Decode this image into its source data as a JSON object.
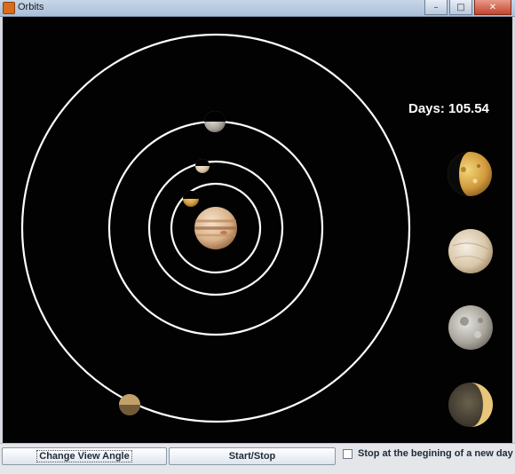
{
  "window": {
    "title": "Orbits",
    "controls": {
      "minimize": "–",
      "maximize": "□",
      "close": "✕"
    }
  },
  "simulation": {
    "days_label": "Days: 105.54",
    "central_body": "jupiter",
    "moons": [
      "io",
      "europa",
      "ganymede",
      "callisto"
    ],
    "orbit_color": "#ffffff",
    "background_color": "#020202"
  },
  "controls": {
    "change_view_label": "Change View Angle",
    "start_stop_label": "Start/Stop",
    "stop_new_day_label": "Stop at the begining of a new day",
    "stop_new_day_checked": false
  }
}
